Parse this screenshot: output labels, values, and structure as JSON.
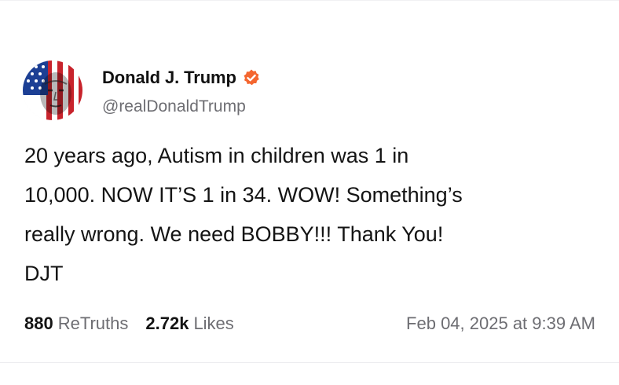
{
  "author": {
    "display_name": "Donald J. Trump",
    "handle": "@realDonaldTrump",
    "verified_icon": "verified-badge-icon",
    "avatar_icon": "flag-portrait-avatar"
  },
  "post": {
    "text": "20 years ago, Autism in children was 1 in\n10,000. NOW IT’S 1 in 34. WOW! Something’s\nreally wrong. We need BOBBY!!!  Thank You!\nDJT"
  },
  "stats": {
    "retruths_count": "880",
    "retruths_label": "ReTruths",
    "likes_count": "2.72k",
    "likes_label": "Likes",
    "timestamp": "Feb 04, 2025 at 9:39 AM"
  },
  "colors": {
    "badge": "#f4662f",
    "text": "#141414",
    "secondary_text": "#6d6d72"
  }
}
